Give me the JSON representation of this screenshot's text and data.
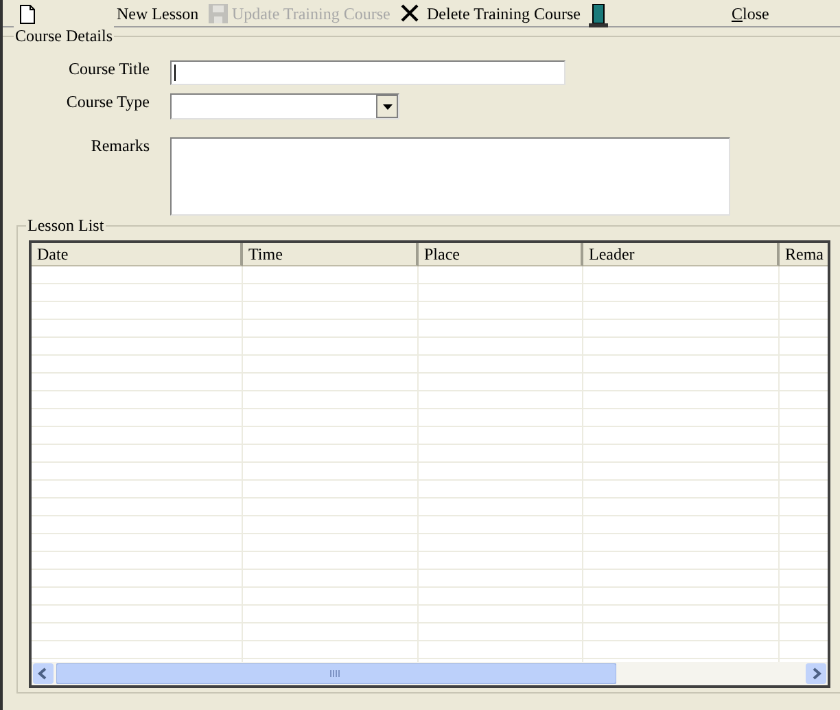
{
  "toolbar": [
    {
      "kind": "new",
      "label": "New Lesson",
      "disabled": false
    },
    {
      "kind": "save",
      "label": "Update Training Course",
      "disabled": true
    },
    {
      "kind": "delete",
      "label": "Delete Training Course",
      "disabled": false
    },
    {
      "kind": "exit",
      "label": "Close",
      "disabled": false
    }
  ],
  "course_details": {
    "title": "Course Details",
    "fields": [
      {
        "kind": "text",
        "label": "Course Title"
      },
      {
        "kind": "dropdown",
        "label": "Course Type"
      },
      {
        "kind": "textarea",
        "label": "Remarks"
      }
    ]
  },
  "lesson_list": {
    "title": "Lesson List",
    "columns": [
      "Date",
      "Time",
      "Place",
      "Leader",
      "Rema"
    ]
  }
}
